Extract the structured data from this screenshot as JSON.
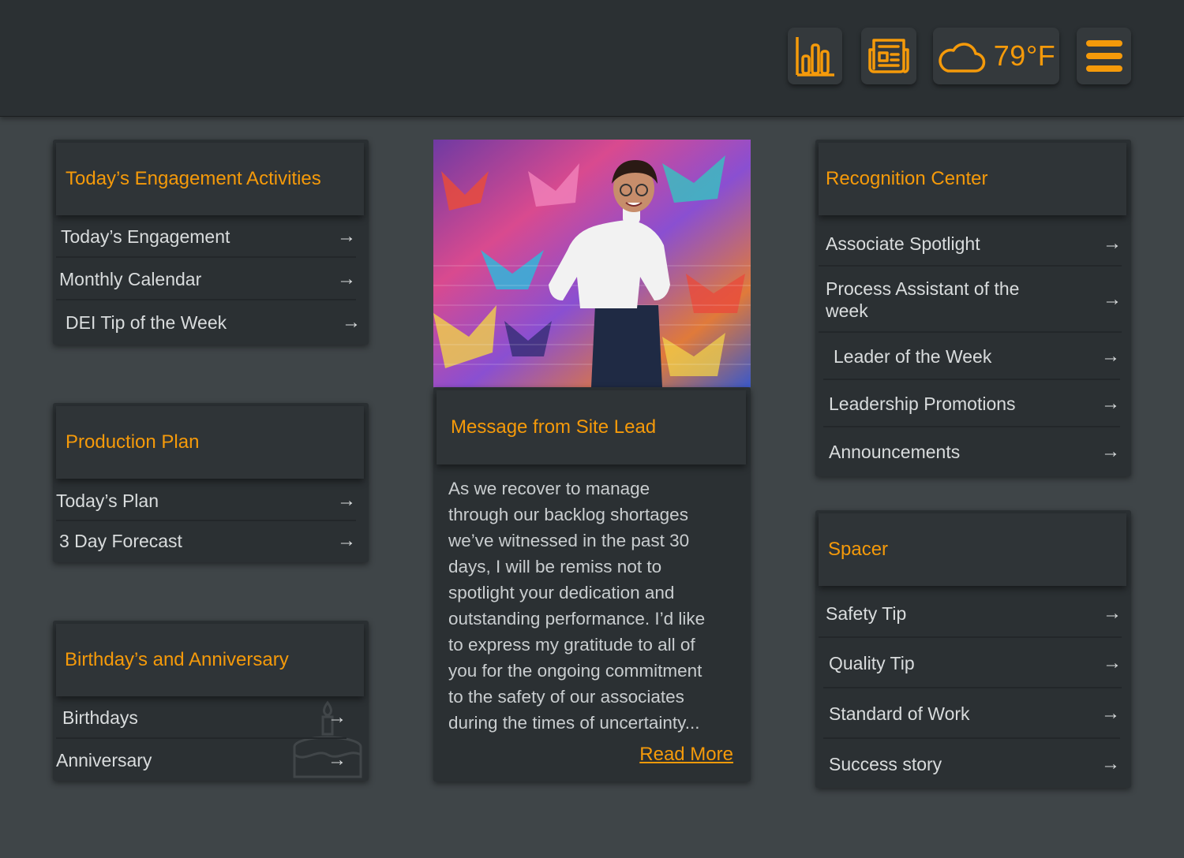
{
  "header": {
    "weather": {
      "temp": "79",
      "unit": "°F"
    }
  },
  "engagement": {
    "title": "Today’s Engagement Activities",
    "items": [
      "Today’s Engagement",
      "Monthly Calendar",
      "DEI Tip of the Week"
    ]
  },
  "production": {
    "title": "Production Plan",
    "items": [
      "Today’s Plan",
      "3 Day Forecast"
    ]
  },
  "birthday": {
    "title": "Birthday’s and Anniversary",
    "items": [
      "Birthdays",
      "Anniversary"
    ]
  },
  "message": {
    "title": "Message from Site Lead",
    "body": " As we recover to manage\nthrough our backlog shortages\nwe’ve witnessed in the past 30\ndays, I will be remiss not to\nspotlight your dedication and\noutstanding performance. I’d like\nto express my gratitude to all of\nyou for the ongoing commitment\nto the safety of our associates\nduring the times of uncertainty...",
    "read_more": "Read More"
  },
  "recognition": {
    "title": "Recognition Center",
    "items": [
      "Associate Spotlight",
      "Process Assistant of the week",
      "Leader of the Week",
      "Leadership Promotions",
      "Announcements"
    ]
  },
  "spacer": {
    "title": "Spacer",
    "items": [
      "Safety Tip",
      "Quality Tip",
      "Standard of Work",
      "Success story"
    ]
  },
  "icons": {
    "arrow": "→",
    "stats": "bar-chart-icon",
    "news": "newspaper-icon",
    "weather": "cloud-icon",
    "menu": "hamburger-menu-icon"
  },
  "colors": {
    "accent": "#f59a0a",
    "background": "#3f4548",
    "card": "#2b3033"
  }
}
